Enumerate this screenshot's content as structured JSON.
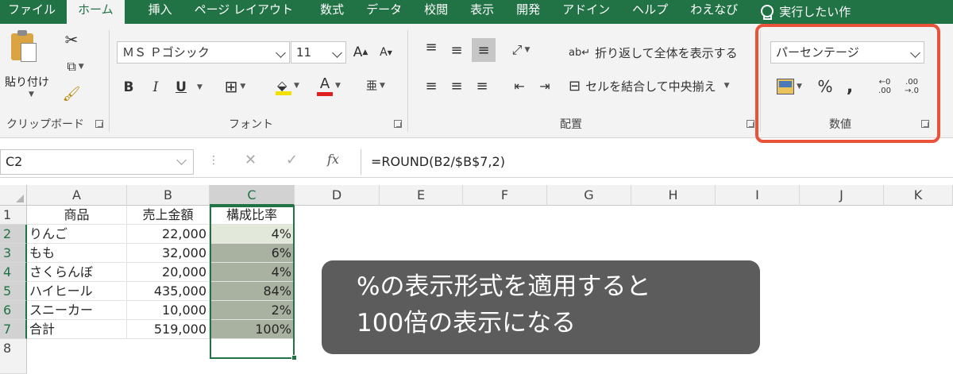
{
  "tabs": [
    "ファイル",
    "ホーム",
    "挿入",
    "ページ レイアウト",
    "数式",
    "データ",
    "校閲",
    "表示",
    "開発",
    "アドイン",
    "ヘルプ",
    "わえなび"
  ],
  "tell_me": "実行したい作",
  "clipboard": {
    "paste_label": "貼り付け",
    "group_label": "クリップボード"
  },
  "font": {
    "font_name": "ＭＳ Ｐゴシック",
    "font_size": "11",
    "group_label": "フォント",
    "bold": "B",
    "italic": "I",
    "underline": "U",
    "grow": "A",
    "shrink": "A"
  },
  "alignment": {
    "wrap_text": "折り返して全体を表示する",
    "merge_center": "セルを結合して中央揃え",
    "group_label": "配置"
  },
  "number": {
    "format": "パーセンテージ",
    "group_label": "数値",
    "percent": "%",
    "comma": ","
  },
  "colors": {
    "ribbon_green": "#217346",
    "highlight": "#e8533a"
  },
  "formula_bar": {
    "name_box": "C2",
    "formula": "=ROUND(B2/$B$7,2)",
    "fx": "fx"
  },
  "columns": [
    "A",
    "B",
    "C",
    "D",
    "E",
    "F",
    "G",
    "H",
    "I",
    "J",
    "K"
  ],
  "rows": [
    "1",
    "2",
    "3",
    "4",
    "5",
    "6",
    "7",
    "8"
  ],
  "table": {
    "headers": [
      "商品",
      "売上金額",
      "構成比率"
    ],
    "data": [
      [
        "りんご",
        "22,000",
        "4%"
      ],
      [
        "もも",
        "32,000",
        "6%"
      ],
      [
        "さくらんぼ",
        "20,000",
        "4%"
      ],
      [
        "ハイヒール",
        "435,000",
        "84%"
      ],
      [
        "スニーカー",
        "10,000",
        "2%"
      ],
      [
        "合計",
        "519,000",
        "100%"
      ]
    ]
  },
  "callout": {
    "line1": "%の表示形式を適用すると",
    "line2": "100倍の表示になる"
  }
}
